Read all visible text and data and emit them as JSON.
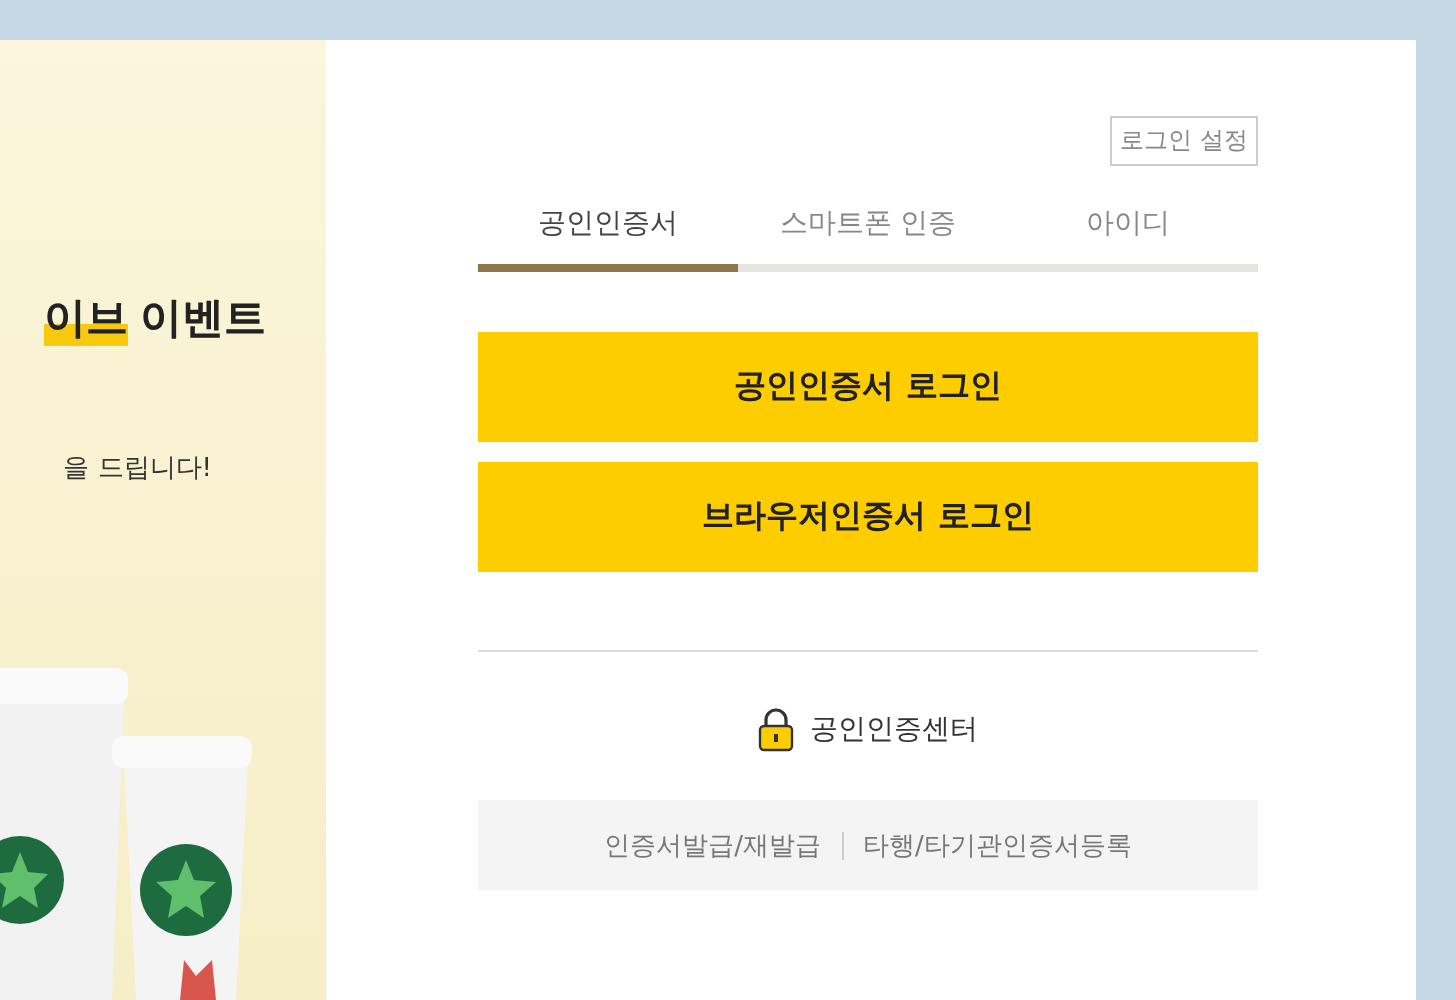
{
  "banner": {
    "heading_highlight": "이브",
    "heading_rest": "이벤트",
    "subtitle": "을 드립니다!"
  },
  "login_settings": "로그인 설정",
  "tabs": [
    {
      "label": "공인인증서",
      "selected": true
    },
    {
      "label": "스마트폰 인증",
      "selected": false
    },
    {
      "label": "아이디",
      "selected": false
    }
  ],
  "buttons": [
    "공인인증서 로그인",
    "브라우저인증서 로그인"
  ],
  "cert_center": "공인인증센터",
  "footer_links": [
    "인증서발급/재발급",
    "타행/타기관인증서등록"
  ]
}
